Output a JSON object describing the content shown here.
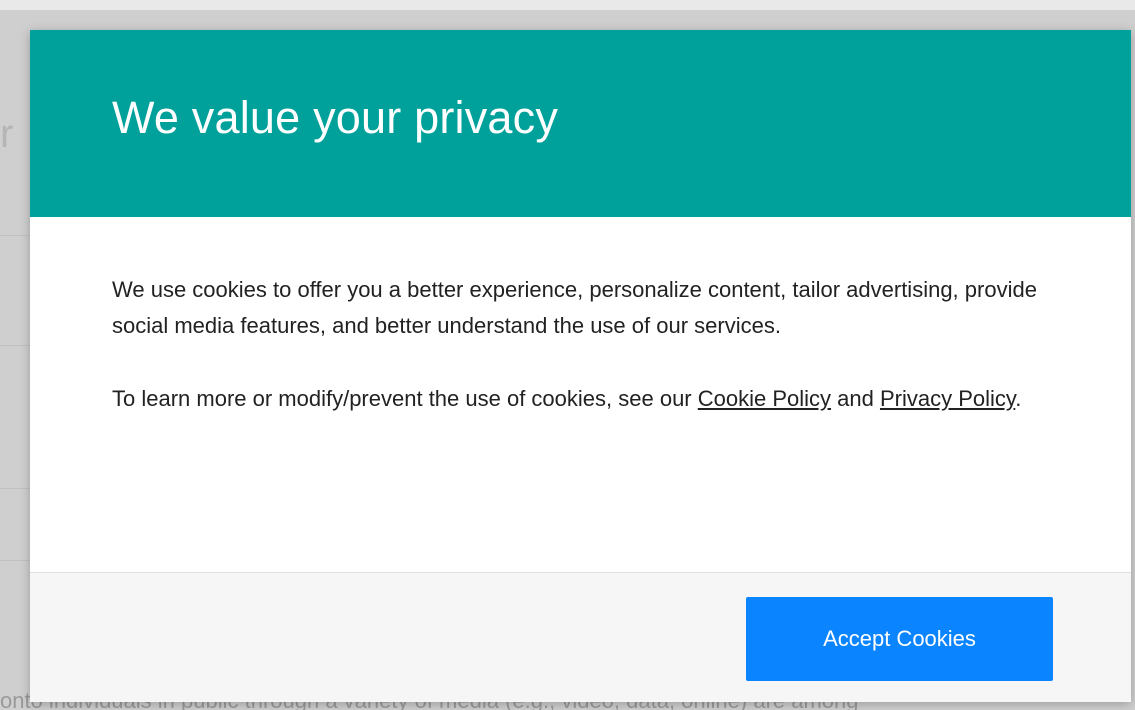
{
  "background": {
    "heading_fragment": "r",
    "body_fragment": "onto individuals in public through a variety of media (e.g., video, data, online) are among"
  },
  "modal": {
    "title": "We value your privacy",
    "paragraph1": "We use cookies to offer you a better experience, personalize content, tailor advertising, provide social media features, and better understand the use of our services.",
    "paragraph2_prefix": "To learn more or modify/prevent the use of cookies, see our ",
    "cookie_policy_link": "Cookie Policy",
    "paragraph2_mid": " and ",
    "privacy_policy_link": "Privacy Policy",
    "paragraph2_suffix": ".",
    "accept_button": "Accept Cookies"
  },
  "colors": {
    "header_teal": "#00a19b",
    "button_blue": "#0a84ff",
    "footer_gray": "#f6f6f6"
  }
}
